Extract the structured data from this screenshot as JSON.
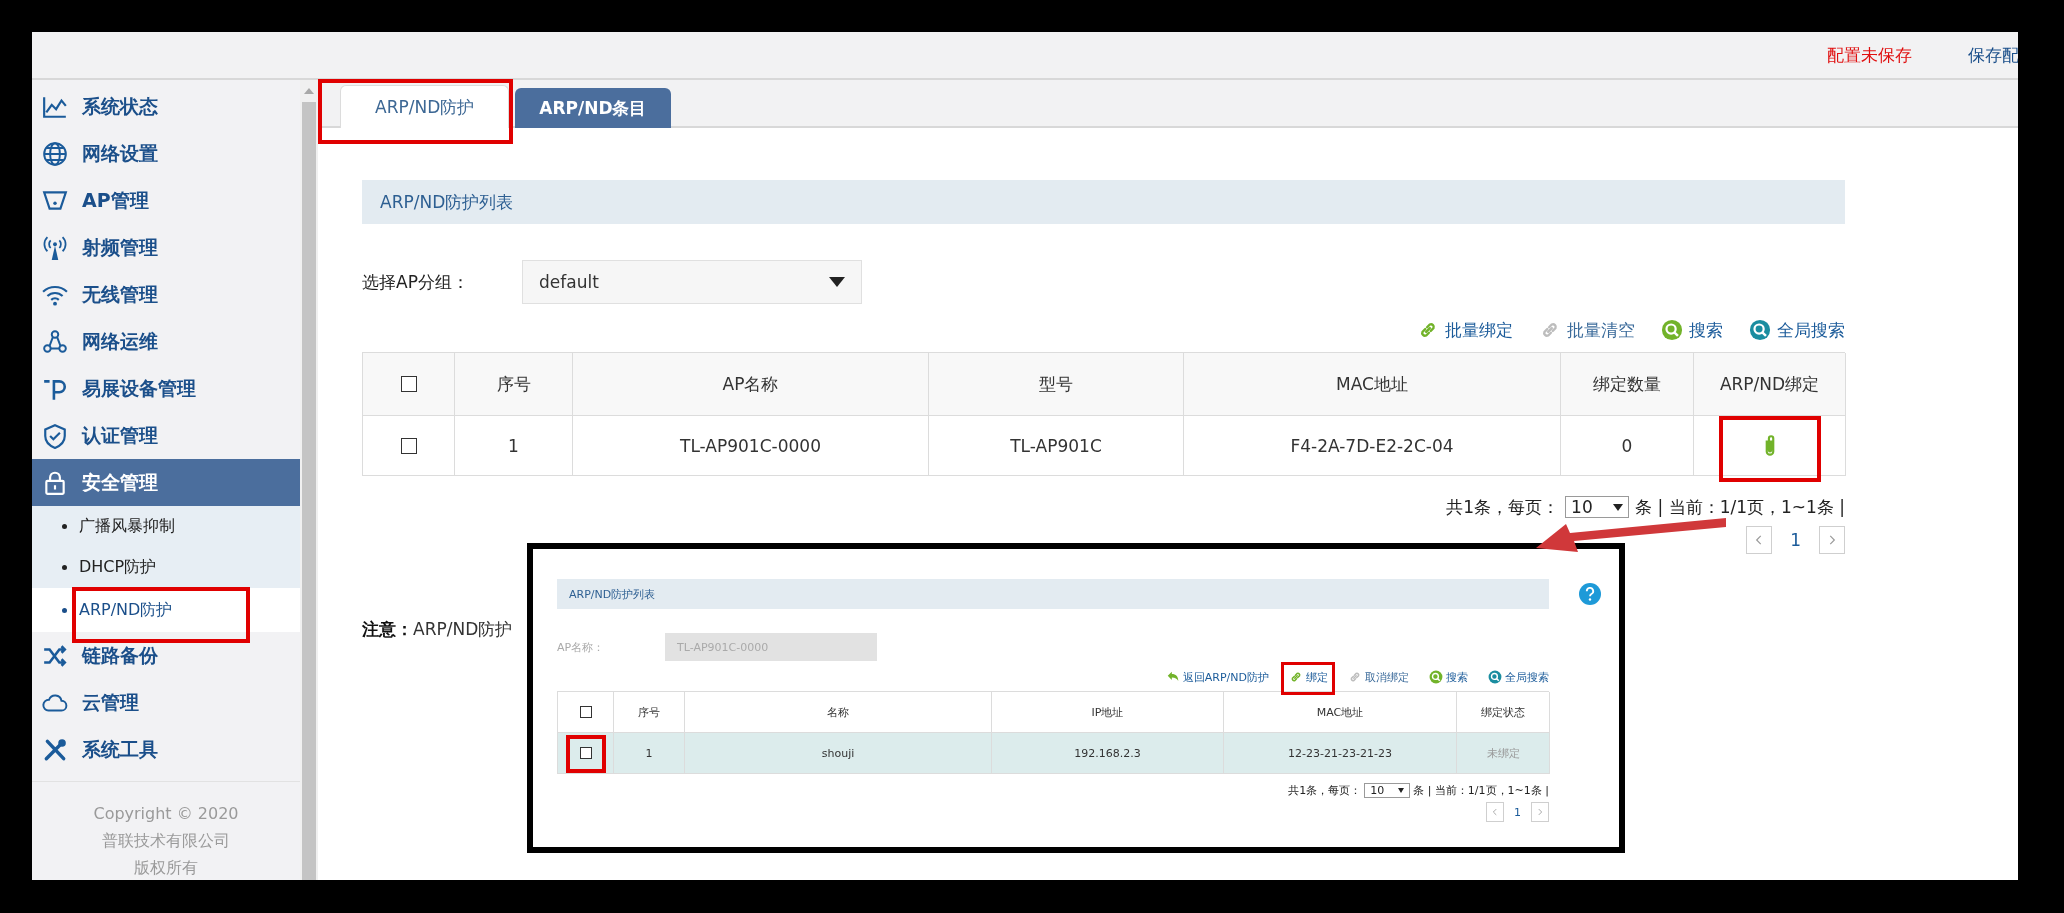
{
  "header": {
    "unsaved_notice": "配置未保存",
    "save_link": "保存配"
  },
  "sidebar": {
    "items": [
      {
        "label": "系统状态",
        "kind": "chart",
        "selected": false
      },
      {
        "label": "网络设置",
        "kind": "globe",
        "selected": false
      },
      {
        "label": "AP管理",
        "kind": "ap",
        "selected": false
      },
      {
        "label": "射频管理",
        "kind": "antenna",
        "selected": false
      },
      {
        "label": "无线管理",
        "kind": "wifi",
        "selected": false
      },
      {
        "label": "网络运维",
        "kind": "nodes",
        "selected": false
      },
      {
        "label": "易展设备管理",
        "kind": "ext",
        "selected": false
      },
      {
        "label": "认证管理",
        "kind": "shield",
        "selected": false
      },
      {
        "label": "安全管理",
        "kind": "lock",
        "selected": true,
        "children": [
          {
            "label": "广播风暴抑制",
            "selected": false,
            "highlighted": false
          },
          {
            "label": "DHCP防护",
            "selected": false,
            "highlighted": false
          },
          {
            "label": "ARP/ND防护",
            "selected": true,
            "highlighted": true
          }
        ]
      },
      {
        "label": "链路备份",
        "kind": "shuffle",
        "selected": false
      },
      {
        "label": "云管理",
        "kind": "cloud",
        "selected": false
      },
      {
        "label": "系统工具",
        "kind": "tools",
        "selected": false
      }
    ],
    "copyright": [
      "Copyright © 2020",
      "普联技术有限公司",
      "版权所有"
    ]
  },
  "tabs": [
    {
      "label": "ARP/ND防护",
      "selected": true,
      "highlighted": true
    },
    {
      "label": "ARP/ND条目",
      "selected": false,
      "highlighted": false
    }
  ],
  "panel": {
    "title": "ARP/ND防护列表",
    "group_label": "选择AP分组：",
    "group_value": "default",
    "toolbar": [
      {
        "label": "批量绑定",
        "kind": "link",
        "disabled": false
      },
      {
        "label": "批量清空",
        "kind": "link",
        "disabled": true
      },
      {
        "label": "搜索",
        "kind": "search"
      },
      {
        "label": "全局搜索",
        "kind": "global-search"
      }
    ],
    "table": {
      "select_all": {
        "checked": false
      },
      "columns": [
        "序号",
        "AP名称",
        "型号",
        "MAC地址",
        "绑定数量",
        "ARP/ND绑定"
      ],
      "rows": [
        {
          "checked": false,
          "selected": false,
          "highlighted": true,
          "cells": [
            "1",
            "TL-AP901C-0000",
            "TL-AP901C",
            "F4-2A-7D-E2-2C-04",
            "0"
          ],
          "kind": "attach"
        }
      ]
    },
    "pagination": {
      "summary": "共1条，每页：",
      "per_page": "10",
      "suffix": "条 | 当前：1/1页，1~1条 |",
      "page": "1"
    },
    "note": "**注意：**ARP/ND防护"
  },
  "inset": {
    "title": "ARP/ND防护列表",
    "ap_label": "AP名称：",
    "ap_value": "TL-AP901C-0000",
    "ap_disabled": true,
    "toolbar": [
      {
        "label": "返回ARP/ND防护",
        "kind": "back",
        "highlighted": false
      },
      {
        "label": "绑定",
        "kind": "link",
        "disabled": false,
        "highlighted": true
      },
      {
        "label": "取消绑定",
        "kind": "link",
        "disabled": true,
        "highlighted": false
      },
      {
        "label": "搜索",
        "kind": "search",
        "highlighted": false
      },
      {
        "label": "全局搜索",
        "kind": "global-search",
        "highlighted": false
      }
    ],
    "table": {
      "select_all": {
        "checked": false
      },
      "columns": [
        "序号",
        "名称",
        "IP地址",
        "MAC地址",
        "绑定状态"
      ],
      "rows": [
        {
          "checked": false,
          "selected": true,
          "highlighted": true,
          "cells": [
            "1",
            "shouji",
            "192.168.2.3",
            "12-23-21-23-21-23",
            "未绑定"
          ],
          "kind": "status"
        }
      ]
    },
    "pagination": {
      "summary": "共1条，每页：",
      "per_page": "10",
      "suffix": "条 | 当前：1/1页，1~1条 |",
      "page": "1"
    }
  }
}
